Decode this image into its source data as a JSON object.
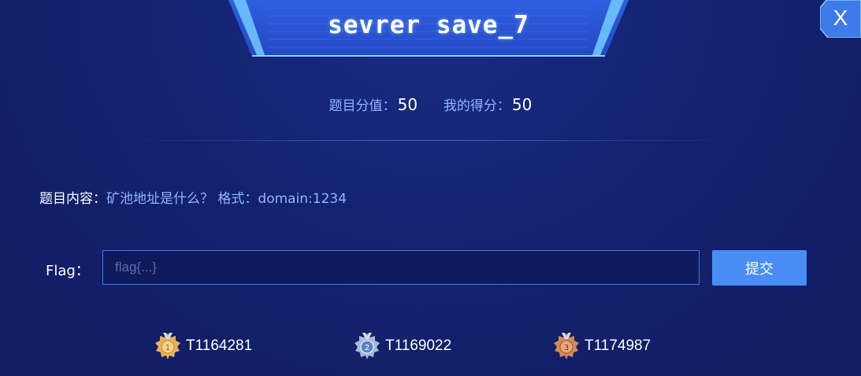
{
  "dialog": {
    "title": "sevrer save_7",
    "close_label": "X"
  },
  "score": {
    "question_value_label": "题目分值：",
    "question_value": "50",
    "my_score_label": "我的得分：",
    "my_score": "50"
  },
  "question": {
    "label": "题目内容：",
    "text": "矿池地址是什么？ 格式：domain:1234"
  },
  "flag": {
    "label": "Flag：",
    "placeholder": "flag{...}",
    "value": "",
    "submit_label": "提交"
  },
  "rankings": [
    {
      "medal": "gold-medal-icon",
      "medal_number": "1",
      "team": "T1164281"
    },
    {
      "medal": "silver-medal-icon",
      "medal_number": "2",
      "team": "T1169022"
    },
    {
      "medal": "bronze-medal-icon",
      "medal_number": "3",
      "team": "T1174987"
    }
  ],
  "colors": {
    "background": "#121f6b",
    "accent": "#4a8ef5",
    "label_blue": "#8fb6ff",
    "gold": "#e8b15a",
    "silver": "#a9b8d6",
    "bronze": "#d08a5c"
  }
}
